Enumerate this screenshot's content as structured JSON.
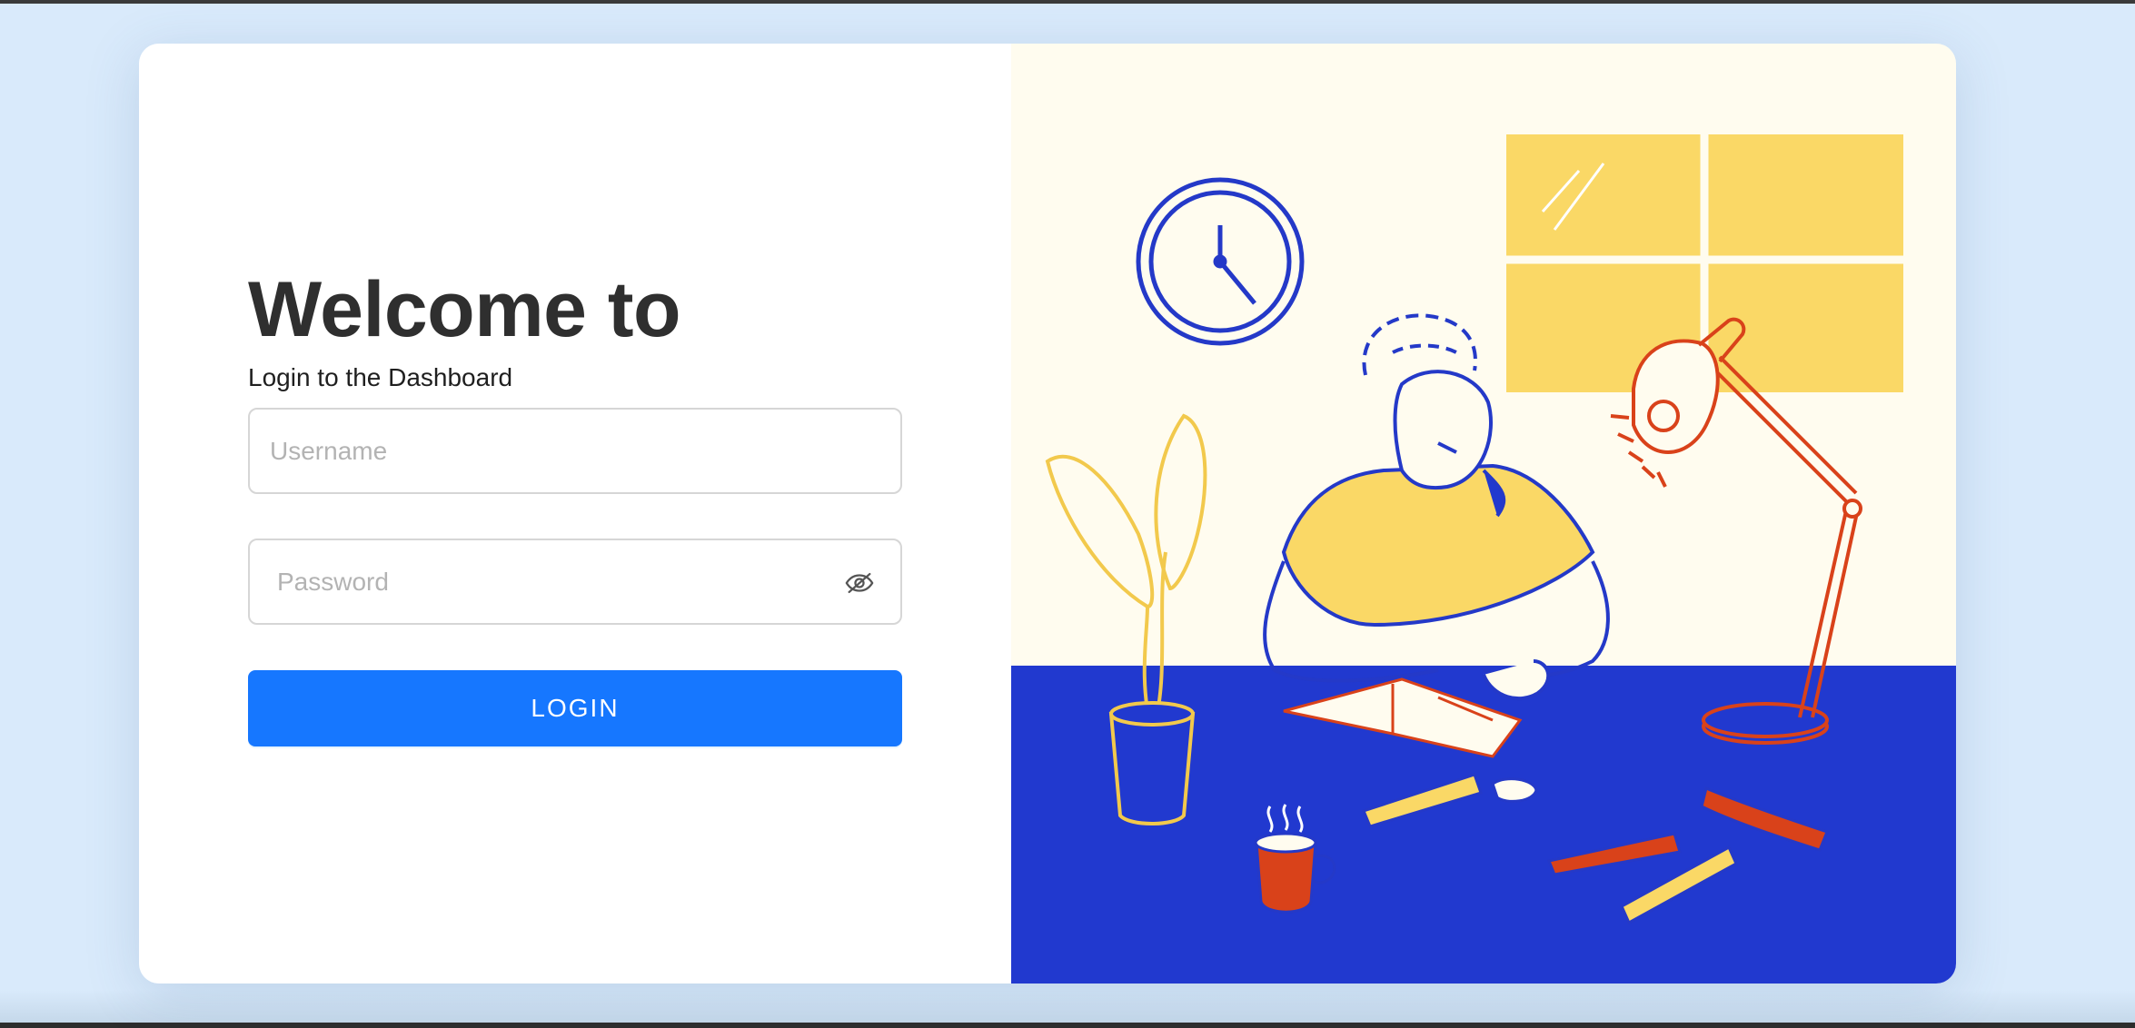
{
  "login": {
    "title": "Welcome to",
    "subtitle": "Login to the Dashboard",
    "username_placeholder": "Username",
    "password_placeholder": "Password",
    "button_label": "LOGIN",
    "password_toggle_icon": "eye-off-icon"
  },
  "illustration": {
    "subject": "person-writing-at-desk",
    "colors": {
      "wall": "#fffcef",
      "desk": "#2139cf",
      "accent_yellow": "#fad866",
      "accent_orange": "#d9421a",
      "line_blue": "#2439c8"
    }
  },
  "theme": {
    "primary": "#1677ff",
    "page_background": "#d9eafb"
  }
}
